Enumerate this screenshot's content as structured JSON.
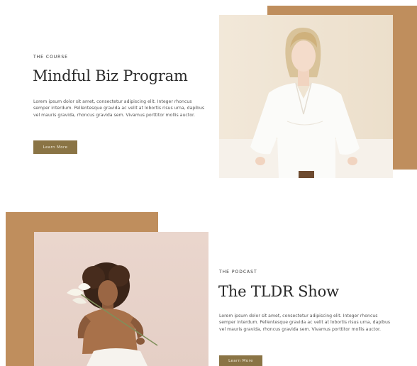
{
  "course": {
    "eyebrow": "THE COURSE",
    "title": "Mindful Biz Program",
    "body": "Lorem ipsum dolor sit amet, consectetur adipiscing elit. Integer rhoncus semper interdum. Pellentesque gravida ac velit at lobortis risus urna, dapibus vel mauris gravida, rhoncus gravida sem. Vivamus porttitor mollis auctor.",
    "button_label": "Learn More"
  },
  "podcast": {
    "eyebrow": "THE PODCAST",
    "title": "The TLDR Show",
    "body": "Lorem ipsum dolor sit amet, consectetur adipiscing elit. Integer rhoncus semper interdum. Pellentesque gravida ac velit at lobortis risus urna, dapibus vel mauris gravida, rhoncus gravida sem. Vivamus porttitor mollis auctor.",
    "button_label": "Learn More"
  },
  "colors": {
    "accent_block": "#bf8e5d",
    "button": "#8a7445"
  }
}
